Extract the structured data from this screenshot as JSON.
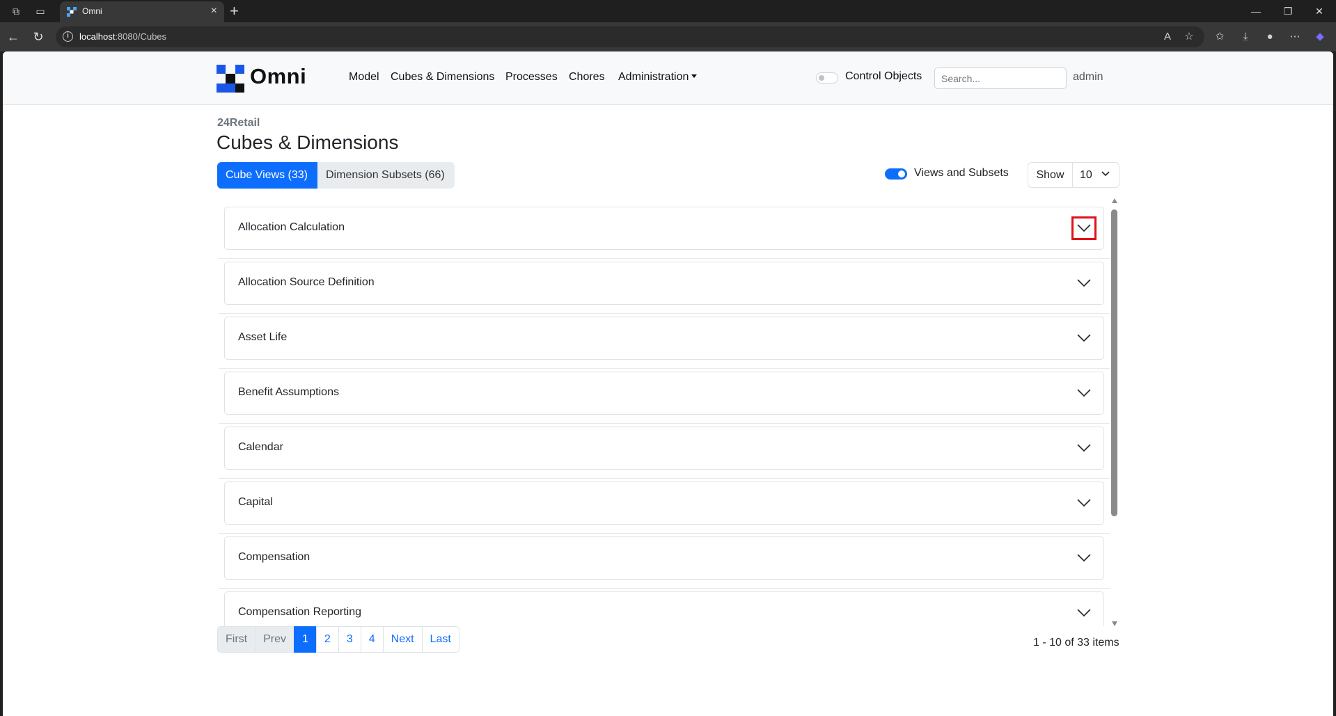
{
  "browser": {
    "tab_title": "Omni",
    "url_host": "localhost",
    "url_rest": ":8080/Cubes"
  },
  "nav": {
    "brand": "Omni",
    "links": [
      "Model",
      "Cubes & Dimensions",
      "Processes",
      "Chores"
    ],
    "admin_menu": "Administration",
    "control_objects_label": "Control Objects",
    "search_placeholder": "Search...",
    "user": "admin"
  },
  "page": {
    "breadcrumb": "24Retail",
    "title": "Cubes & Dimensions",
    "tab_cube_views": "Cube Views (33)",
    "tab_dimension_subsets": "Dimension Subsets (66)",
    "views_toggle_label": "Views and Subsets",
    "views_toggle_on": true,
    "show_label": "Show",
    "show_value": "10"
  },
  "items": [
    "Allocation Calculation",
    "Allocation Source Definition",
    "Asset Life",
    "Benefit Assumptions",
    "Calendar",
    "Capital",
    "Compensation",
    "Compensation Reporting"
  ],
  "pagination": {
    "first": "First",
    "prev": "Prev",
    "pages": [
      "1",
      "2",
      "3",
      "4"
    ],
    "current": "1",
    "next": "Next",
    "last": "Last",
    "summary": "1 - 10 of 33 items"
  },
  "colors": {
    "primary": "#0d6efd",
    "highlight_box": "#e0101a"
  }
}
